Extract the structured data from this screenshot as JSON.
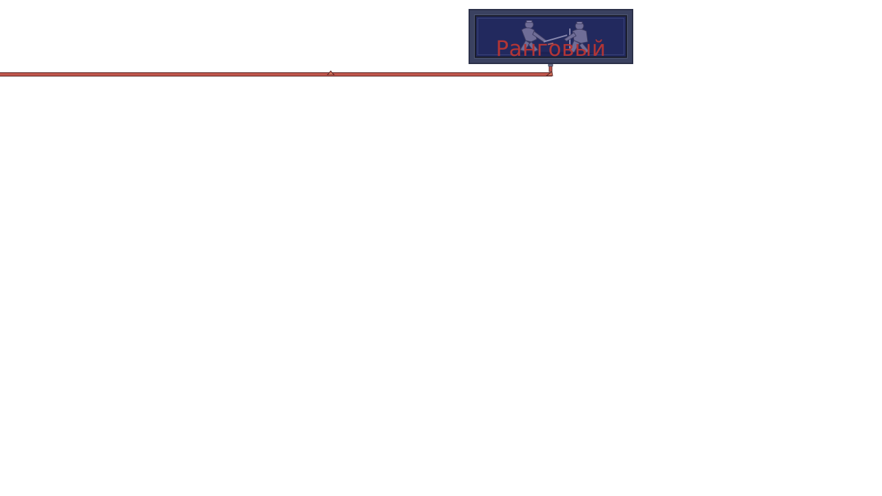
{
  "mode_button": {
    "label": "Ранговый",
    "icon": "duel-players-icon"
  },
  "colors": {
    "background": "#ffffff",
    "card_frame": "#3a4160",
    "card_fill": "#22295e",
    "label": "#b23535",
    "rail": "#c0574d"
  }
}
